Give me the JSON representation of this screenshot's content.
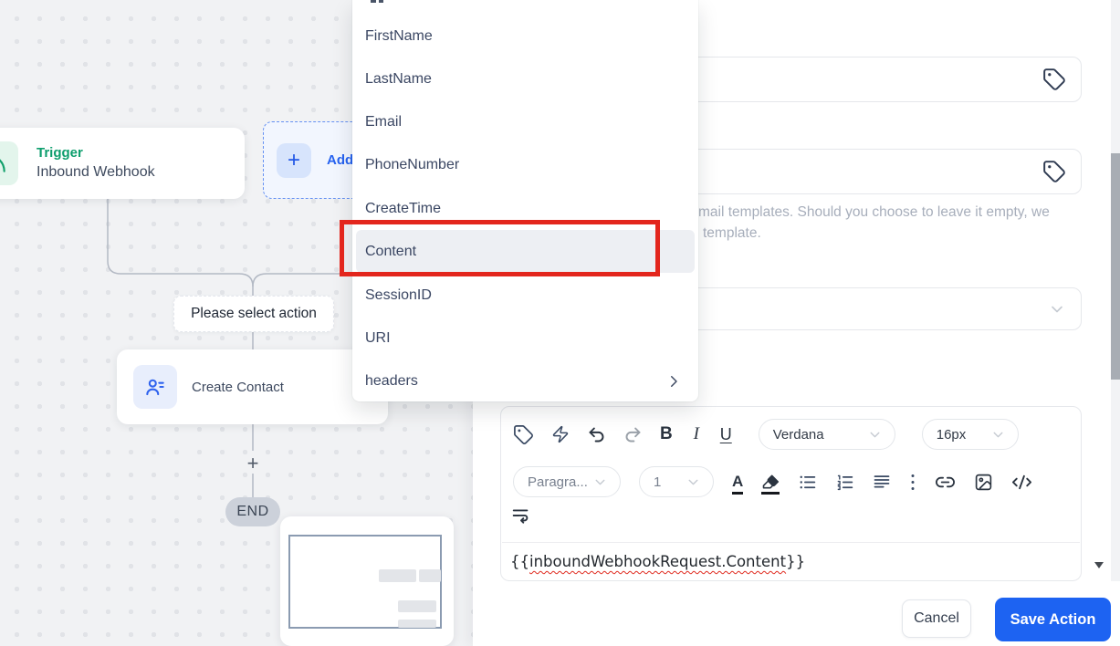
{
  "canvas": {
    "trigger_node": {
      "title": "Trigger",
      "subtitle": "Inbound Webhook"
    },
    "add_button": {
      "plus": "+",
      "label": "Add"
    },
    "action_prompt": "Please select action",
    "create_contact_node": {
      "label": "Create Contact"
    },
    "connector_plus": "+",
    "end_label": "END"
  },
  "dropdown": {
    "items": [
      {
        "label": "FirstName"
      },
      {
        "label": "LastName"
      },
      {
        "label": "Email"
      },
      {
        "label": "PhoneNumber"
      },
      {
        "label": "CreateTime"
      },
      {
        "label": "Content",
        "highlighted": true
      },
      {
        "label": "SessionID"
      },
      {
        "label": "URI"
      },
      {
        "label": "headers",
        "has_submenu": true
      }
    ]
  },
  "panel": {
    "description_line1": "mail templates. Should you choose to leave it empty, we",
    "description_line2": "template.",
    "toolbar": {
      "bold_label": "B",
      "italic_label": "I",
      "underline_label": "U",
      "font_color_label": "A",
      "font_family_value": "Verdana",
      "font_size_value": "16px",
      "paragraph_value": "Paragra...",
      "line_height_value": "1"
    },
    "editor_content": {
      "open": "{{",
      "token": "inboundWebhookRequest.Content",
      "close": "}}"
    },
    "footer": {
      "cancel_label": "Cancel",
      "save_label": "Save Action"
    }
  },
  "colors": {
    "accent_blue": "#2563eb",
    "save_button_blue": "#1d63f2",
    "trigger_green": "#0d9e6d",
    "annotation_red": "#e3261d",
    "canvas_background": "#f1f2f4",
    "end_badge_gray": "#ccd1da"
  }
}
